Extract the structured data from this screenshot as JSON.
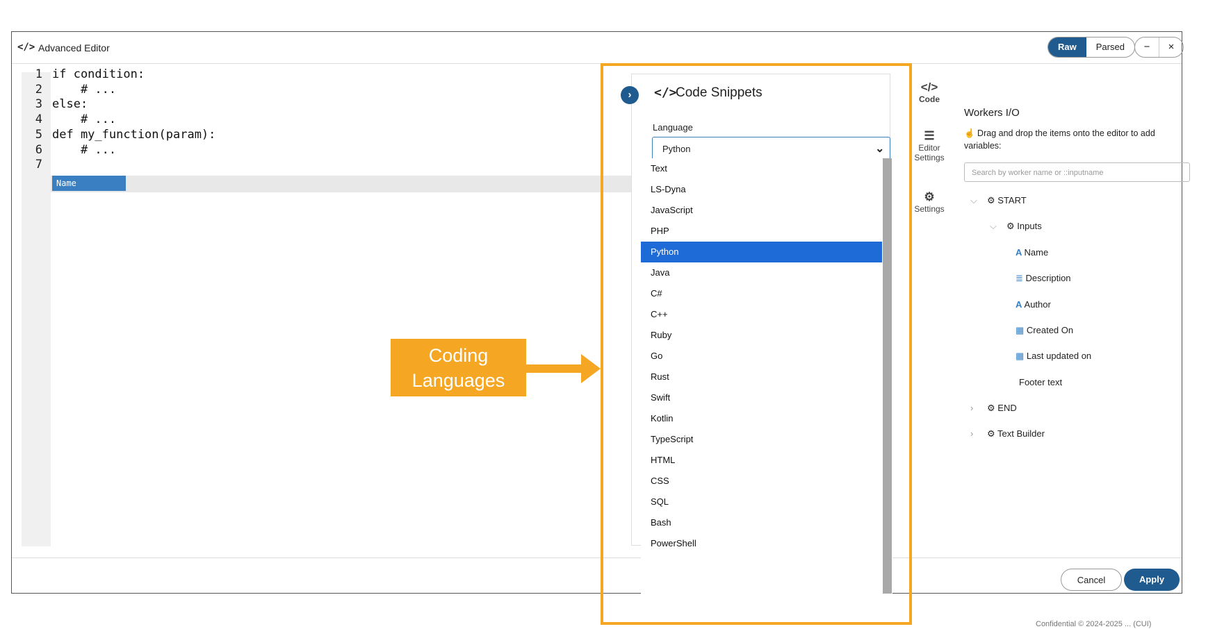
{
  "window": {
    "title": "Advanced Editor",
    "title_icon": "</>",
    "view_toggle": {
      "raw": "Raw",
      "parsed": "Parsed"
    },
    "minimize": "−",
    "close": "×"
  },
  "editor": {
    "lines": [
      {
        "num": "1",
        "code": "if condition:"
      },
      {
        "num": "2",
        "code": "    # ..."
      },
      {
        "num": "3",
        "code": "else:"
      },
      {
        "num": "4",
        "code": "    # ..."
      },
      {
        "num": "5",
        "code": "def my_function(param):"
      },
      {
        "num": "6",
        "code": "    # ..."
      },
      {
        "num": "7",
        "code": ""
      }
    ],
    "chip_text": "Name"
  },
  "snippets": {
    "icon": "</>",
    "title": "Code Snippets",
    "language_label": "Language",
    "selected_language": "Python",
    "languages": [
      "Text",
      "LS-Dyna",
      "JavaScript",
      "PHP",
      "Python",
      "Java",
      "C#",
      "C++",
      "Ruby",
      "Go",
      "Rust",
      "Swift",
      "Kotlin",
      "TypeScript",
      "HTML",
      "CSS",
      "SQL",
      "Bash",
      "PowerShell"
    ]
  },
  "side_tabs": {
    "code": "Code",
    "editor_settings_1": "Editor",
    "editor_settings_2": "Settings",
    "settings": "Settings"
  },
  "workers_io": {
    "title": "Workers I/O",
    "hint": "Drag and drop the items onto the editor to add variables:",
    "search_placeholder": "Search by worker name or ::inputname",
    "start": "START",
    "inputs": "Inputs",
    "fields": [
      "Name",
      "Description",
      "Author",
      "Created On",
      "Last updated on",
      "Footer text"
    ],
    "end": "END",
    "text_builder": "Text Builder"
  },
  "footer": {
    "cancel": "Cancel",
    "apply": "Apply"
  },
  "annotation": {
    "line1": "Coding",
    "line2": "Languages"
  },
  "page_footer": "Confidential © 2024-2025 ... (CUI)",
  "colors": {
    "accent": "#1f5b8f",
    "selection": "#1e6ad6",
    "callout": "#f5a623"
  }
}
